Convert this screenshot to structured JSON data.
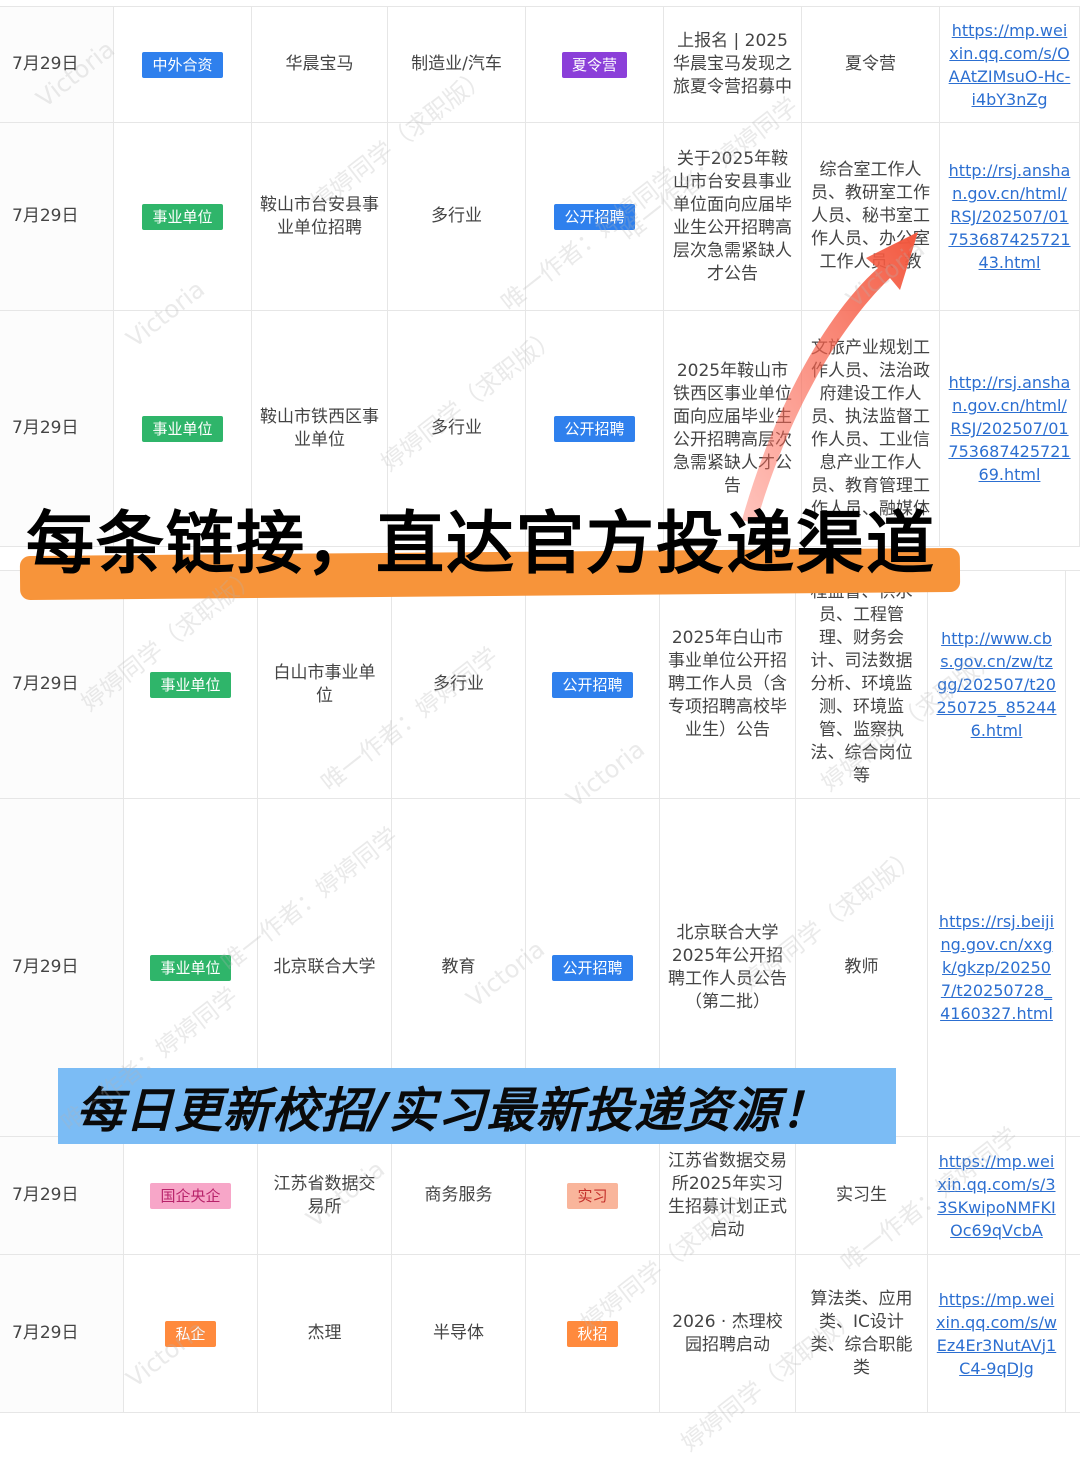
{
  "banner_top": "每条链接，直达官方投递渠道",
  "banner_bottom": "每日更新校招/实习最新投递资源！",
  "watermarks": [
    "Victoria",
    "婷婷同学（求职版）",
    "唯一作者：婷婷同学"
  ],
  "rows": [
    {
      "date": "7月29日",
      "type": "中外合资",
      "type_color": "blue",
      "company": "华晨宝马",
      "industry": "制造业/汽车",
      "kind": "夏令营",
      "kind_color": "purple",
      "title": "上报名 | 2025华晨宝马发现之旅夏令营招募中",
      "positions": "夏令营",
      "link": "https://mp.weixin.qq.com/s/OAAtZIMsuO-Hc-i4bY3nZg"
    },
    {
      "date": "7月29日",
      "type": "事业单位",
      "type_color": "green",
      "company": "鞍山市台安县事业单位招聘",
      "industry": "多行业",
      "kind": "公开招聘",
      "kind_color": "blue",
      "title": "关于2025年鞍山市台安县事业单位面向应届毕业生公开招聘高层次急需紧缺人才公告",
      "positions": "综合室工作人员、教研室工作人员、秘书室工作人员、办公室工作人员、教",
      "link": "http://rsj.anshan.gov.cn/html/RSJ/202507/0175368742572143.html"
    },
    {
      "date": "7月29日",
      "type": "事业单位",
      "type_color": "green",
      "company": "鞍山市铁西区事业单位",
      "industry": "多行业",
      "kind": "公开招聘",
      "kind_color": "blue",
      "title": "2025年鞍山市铁西区事业单位面向应届毕业生公开招聘高层次急需紧缺人才公告",
      "positions": "文旅产业规划工作人员、法治政府建设工作人员、执法监督工作人员、工业信息产业工作人员、教育管理工作人员、融媒体",
      "link": "http://rsj.anshan.gov.cn/html/RSJ/202507/0175368742572169.html"
    },
    {
      "date": "7月29日",
      "type": "事业单位",
      "type_color": "green",
      "company": "白山市事业单位",
      "industry": "多行业",
      "kind": "公开招聘",
      "kind_color": "blue",
      "title": "2025年白山市事业单位公开招聘工作人员（含专项招聘高校毕业生）公告",
      "positions": "程监督、供水员、工程管理、财务会计、司法数据分析、环境监测、环境监管、监察执法、综合岗位等",
      "link": "http://www.cbs.gov.cn/zw/tzgg/202507/t20250725_852446.html"
    },
    {
      "date": "7月29日",
      "type": "事业单位",
      "type_color": "green",
      "company": "北京联合大学",
      "industry": "教育",
      "kind": "公开招聘",
      "kind_color": "blue",
      "title": "北京联合大学2025年公开招聘工作人员公告（第二批）",
      "positions": "教师",
      "link": "https://rsj.beijing.gov.cn/xxgk/gkzp/202507/t20250728_4160327.html"
    },
    {
      "date": "7月29日",
      "type": "国企央企",
      "type_color": "pink",
      "company": "江苏省数据交易所",
      "industry": "商务服务",
      "kind": "实习",
      "kind_color": "salmon",
      "title": "江苏省数据交易所2025年实习生招募计划正式启动",
      "positions": "实习生",
      "link": "https://mp.weixin.qq.com/s/33SKwipoNMFKIOc69qVcbA"
    },
    {
      "date": "7月29日",
      "type": "私企",
      "type_color": "orange",
      "company": "杰理",
      "industry": "半导体",
      "kind": "秋招",
      "kind_color": "orange",
      "title": "2026 · 杰理校园招聘启动",
      "positions": "算法类、应用类、IC设计类、综合职能类",
      "link": "https://mp.weixin.qq.com/s/wEz4Er3NutAVj1C4-9qDJg"
    }
  ]
}
